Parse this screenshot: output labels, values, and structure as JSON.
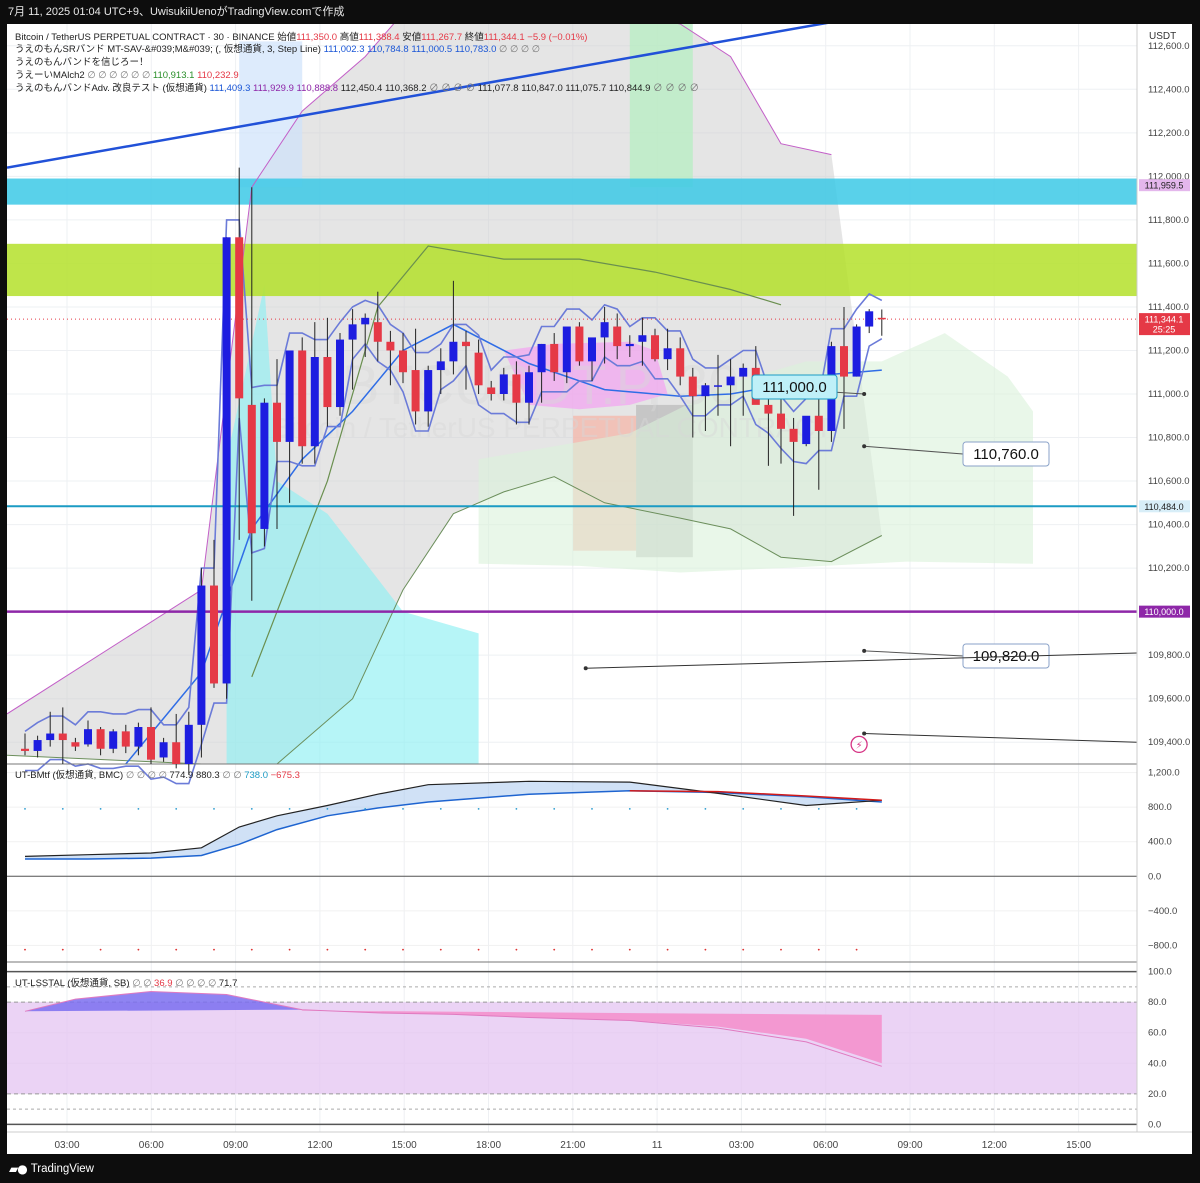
{
  "header": {
    "caption": "7月 11, 2025 01:04 UTC+9、UwisukiiUenoがTradingView.comで作成"
  },
  "footer": {
    "brand": "TradingView",
    "logo_icon": "tradingview-logo-icon"
  },
  "colors": {
    "bull": "#1d1de0",
    "bear": "#e53946",
    "trend_line": "#2151d8",
    "resistance_zone": "#3cc9e6",
    "support_zone": "#b4e12a",
    "level_110000": "#8e27a8",
    "level_110484": "#1b9bc4"
  },
  "chart_data": {
    "type": "candlestick",
    "title": "Bitcoin / TetherUS PERPETUAL CONTRACT · 30 · BINANCE",
    "watermark": [
      "BTCUSDT.P, 30",
      "Bitcoin / TetherUS PERPETUAL CONTRACT"
    ],
    "ohlc_legend": {
      "open_label": "始値",
      "open": "111,350.0",
      "high_label": "高値",
      "high": "111,388.4",
      "low_label": "安値",
      "low": "111,267.7",
      "close_label": "終値",
      "close": "111,344.1",
      "change": "−5.9 (−0.01%)"
    },
    "indicator_legends": [
      {
        "name": "うえのもんSRバンド MT-SAV-&#039;M&#039; (, 仮想通貨, 3, Step Line)",
        "values": [
          "111,002.3",
          "110,784.8",
          "111,000.5",
          "110,783.0",
          "∅",
          "∅",
          "∅",
          "∅"
        ]
      },
      {
        "name": "うえのもんバンドを信じろー！",
        "values": []
      },
      {
        "name": "うえーいMAlch2",
        "values": [
          "∅",
          "∅",
          "∅",
          "∅",
          "∅",
          "∅",
          "110,913.1",
          "110,232.9"
        ]
      },
      {
        "name": "うえのもんバンドAdv. 改良テスト (仮想通貨)",
        "values": [
          "111,409.3",
          "111,929.9",
          "110,888.8",
          "112,450.4",
          "110,368.2",
          "∅",
          "∅",
          "∅",
          "∅",
          "111,077.8",
          "110,847.0",
          "111,075.7",
          "110,844.9",
          "∅",
          "∅",
          "∅",
          "∅"
        ]
      }
    ],
    "currency": "USDT",
    "y_axis": {
      "range": [
        109300,
        112700
      ],
      "ticks": [
        "112,600.0",
        "112,400.0",
        "112,200.0",
        "112,000.0",
        "111,800.0",
        "111,600.0",
        "111,400.0",
        "111,200.0",
        "111,000.0",
        "110,800.0",
        "110,600.0",
        "110,400.0",
        "110,200.0",
        "110,000.0",
        "109,800.0",
        "109,600.0",
        "109,400.0"
      ]
    },
    "x_axis": {
      "ticks": [
        "03:00",
        "06:00",
        "09:00",
        "12:00",
        "15:00",
        "18:00",
        "21:00",
        "11",
        "03:00",
        "06:00",
        "09:00",
        "12:00",
        "15:00"
      ]
    },
    "price_badges": [
      {
        "text": "111,959.5",
        "value": 111959.5
      },
      {
        "text": "111,344.1",
        "sub": "25:25",
        "value": 111344.1
      },
      {
        "text": "110,484.0",
        "value": 110484.0
      },
      {
        "text": "110,000.0",
        "value": 110000.0
      }
    ],
    "level_labels": [
      {
        "text": "111,000.0",
        "value": 111000
      },
      {
        "text": "110,760.0",
        "value": 110760
      },
      {
        "text": "109,820.0",
        "value": 109820
      }
    ],
    "zones": [
      {
        "name": "resistance",
        "from": 111870,
        "to": 111990
      },
      {
        "name": "support",
        "from": 111450,
        "to": 111690
      }
    ],
    "horizontal_levels": [
      110484,
      110000
    ],
    "candles_ohlc": [
      [
        109370,
        109440,
        109340,
        109360
      ],
      [
        109360,
        109430,
        109330,
        109410
      ],
      [
        109410,
        109540,
        109380,
        109440
      ],
      [
        109440,
        109560,
        109300,
        109410
      ],
      [
        109400,
        109420,
        109360,
        109380
      ],
      [
        109390,
        109500,
        109380,
        109460
      ],
      [
        109460,
        109470,
        109340,
        109370
      ],
      [
        109370,
        109460,
        109350,
        109450
      ],
      [
        109450,
        109480,
        109350,
        109380
      ],
      [
        109380,
        109490,
        109340,
        109470
      ],
      [
        109470,
        109560,
        109300,
        109320
      ],
      [
        109330,
        109420,
        109310,
        109400
      ],
      [
        109400,
        109530,
        109280,
        109300
      ],
      [
        109300,
        109540,
        109250,
        109480
      ],
      [
        109480,
        110200,
        109330,
        110120
      ],
      [
        110120,
        110330,
        109650,
        109670
      ],
      [
        109670,
        111720,
        109600,
        111720
      ],
      [
        111720,
        112040,
        110330,
        110980
      ],
      [
        110950,
        111950,
        110050,
        110360
      ],
      [
        110380,
        110980,
        110300,
        110960
      ],
      [
        110960,
        111160,
        110380,
        110780
      ],
      [
        110780,
        111190,
        110500,
        111200
      ],
      [
        111200,
        111260,
        110680,
        110760
      ],
      [
        110760,
        111330,
        110680,
        111170
      ],
      [
        111170,
        111350,
        110850,
        110940
      ],
      [
        110940,
        111280,
        110900,
        111250
      ],
      [
        111250,
        111390,
        111020,
        111320
      ],
      [
        111320,
        111370,
        111170,
        111350
      ],
      [
        111330,
        111470,
        111150,
        111240
      ],
      [
        111240,
        111290,
        111040,
        111200
      ],
      [
        111200,
        111280,
        111050,
        111100
      ],
      [
        111110,
        111300,
        110860,
        110920
      ],
      [
        110920,
        111130,
        110850,
        111110
      ],
      [
        111110,
        111210,
        111000,
        111150
      ],
      [
        111150,
        111520,
        111090,
        111240
      ],
      [
        111240,
        111290,
        111020,
        111220
      ],
      [
        111190,
        111250,
        111000,
        111040
      ],
      [
        111030,
        111060,
        110970,
        111000
      ],
      [
        111000,
        111120,
        110970,
        111090
      ],
      [
        111090,
        111150,
        110860,
        110960
      ],
      [
        110960,
        111130,
        110860,
        111100
      ],
      [
        111100,
        111230,
        110960,
        111230
      ],
      [
        111230,
        111280,
        111060,
        111100
      ],
      [
        111100,
        111280,
        111050,
        111310
      ],
      [
        111310,
        111330,
        111130,
        111150
      ],
      [
        111150,
        111160,
        111060,
        111260
      ],
      [
        111260,
        111400,
        111140,
        111330
      ],
      [
        111310,
        111370,
        111160,
        111220
      ],
      [
        111220,
        111270,
        111170,
        111230
      ],
      [
        111240,
        111350,
        111130,
        111270
      ],
      [
        111270,
        111300,
        111150,
        111160
      ],
      [
        111160,
        111300,
        111110,
        111210
      ],
      [
        111210,
        111260,
        111040,
        111080
      ],
      [
        111080,
        111120,
        110800,
        110990
      ],
      [
        110990,
        111050,
        110830,
        111040
      ],
      [
        111040,
        111180,
        110900,
        111040
      ],
      [
        111040,
        111160,
        110760,
        111080
      ],
      [
        111080,
        111140,
        110900,
        111120
      ],
      [
        111120,
        111220,
        110980,
        110950
      ],
      [
        110950,
        111030,
        110670,
        110910
      ],
      [
        110910,
        110990,
        110680,
        110840
      ],
      [
        110840,
        110890,
        110440,
        110780
      ],
      [
        110770,
        110890,
        110760,
        110900
      ],
      [
        110900,
        110990,
        110560,
        110830
      ],
      [
        110830,
        111240,
        110780,
        111220
      ],
      [
        111220,
        111400,
        110840,
        111080
      ],
      [
        111080,
        111320,
        111080,
        111310
      ],
      [
        111310,
        111390,
        111280,
        111380
      ],
      [
        111350,
        111388.4,
        111267.7,
        111344.1
      ]
    ],
    "indicators": [
      {
        "name": "UT-BMtf (仮想通貨, BMC)",
        "values": [
          "∅",
          "∅",
          "∅",
          "∅",
          "774.9",
          "880.3",
          "∅",
          "∅",
          "738.0",
          "−675.3"
        ],
        "y_axis": {
          "range": [
            -900,
            1300
          ],
          "ticks": [
            "1,200.0",
            "800.0",
            "400.0",
            "0.0",
            "−400.0",
            "−800.0"
          ]
        },
        "series": [
          {
            "values_time": [
              0,
              5,
              10,
              14,
              17,
              20,
              24,
              28,
              32,
              40,
              48,
              55,
              62,
              68
            ],
            "values": [
              200,
              200,
              210,
              240,
              370,
              540,
              700,
              790,
              860,
              950,
              990,
              970,
              920,
              860
            ]
          },
          {
            "values_time": [
              0,
              5,
              10,
              14,
              17,
              20,
              24,
              28,
              32,
              40,
              48,
              55,
              62,
              68
            ],
            "values": [
              230,
              250,
              270,
              330,
              570,
              700,
              820,
              950,
              1060,
              1100,
              1090,
              960,
              820,
              880
            ]
          },
          {
            "values_time": [
              48,
              55,
              62,
              68
            ],
            "values": [
              990,
              980,
              930,
              880
            ]
          }
        ]
      },
      {
        "name": "UT-LSSTAL (仮想通貨, SB)",
        "values": [
          "∅",
          "∅",
          "36.9",
          "∅",
          "∅",
          "∅",
          "∅",
          "71.7"
        ],
        "y_axis": {
          "range": [
            -5,
            105
          ],
          "ticks": [
            "100.0",
            "80.0",
            "60.0",
            "40.0",
            "20.0",
            "0.0"
          ]
        },
        "series": [
          {
            "values_time": [
              0,
              4,
              10,
              16,
              22,
              28,
              34,
              40,
              48,
              55,
              62,
              68
            ],
            "values": [
              74,
              82,
              87,
              85,
              75,
              73,
              72,
              70,
              68,
              63,
              54,
              38
            ]
          },
          {
            "values_time": [
              0,
              4,
              10,
              16,
              22,
              28,
              34,
              40,
              48,
              55,
              62,
              68
            ],
            "values": [
              74,
              76,
              79,
              78,
              75,
              73,
              72,
              70,
              68,
              64,
              56,
              40
            ]
          }
        ]
      }
    ]
  }
}
